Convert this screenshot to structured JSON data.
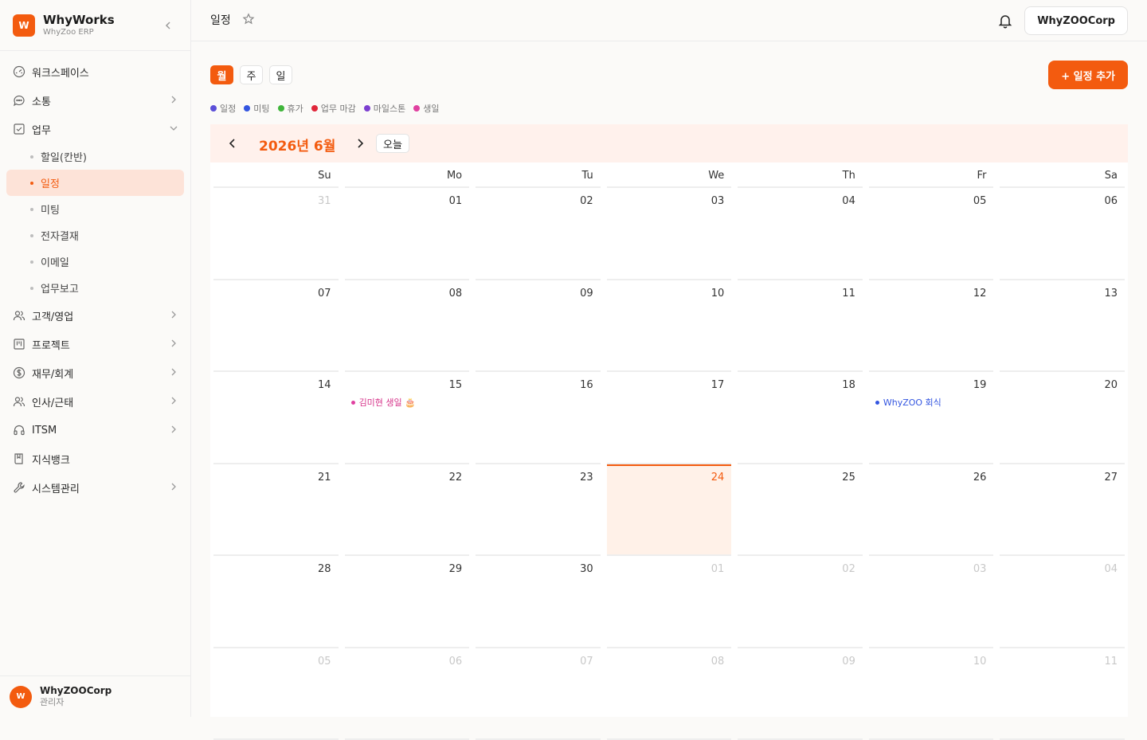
{
  "brand": {
    "logo": "W",
    "name": "WhyWorks",
    "sub": "WhyZoo ERP"
  },
  "nav": {
    "workspace": "워크스페이스",
    "communication": "소통",
    "work": "업무",
    "work_sub": [
      "할일(칸반)",
      "일정",
      "미팅",
      "전자결재",
      "이메일",
      "업무보고"
    ],
    "customers": "고객/영업",
    "projects": "프로젝트",
    "finance": "재무/회계",
    "hr": "인사/근태",
    "itsm": "ITSM",
    "knowledge": "지식뱅크",
    "system": "시스템관리"
  },
  "user": {
    "avatar": "W",
    "name": "WhyZOOCorp",
    "role": "관리자"
  },
  "topbar": {
    "title": "일정",
    "org": "WhyZOOCorp"
  },
  "view_tabs": [
    "월",
    "주",
    "일"
  ],
  "add_button": "+ 일정 추가",
  "legend": [
    {
      "label": "일정",
      "color": "#5b4fd8"
    },
    {
      "label": "미팅",
      "color": "#3355e0"
    },
    {
      "label": "휴가",
      "color": "#3fb53a"
    },
    {
      "label": "업무 마감",
      "color": "#e0263a"
    },
    {
      "label": "마일스톤",
      "color": "#7c3fd0"
    },
    {
      "label": "생일",
      "color": "#e040a0"
    }
  ],
  "calendar": {
    "title": "2026년 6월",
    "today_label": "오늘",
    "weekdays": [
      "Su",
      "Mo",
      "Tu",
      "We",
      "Th",
      "Fr",
      "Sa"
    ],
    "days": [
      [
        "31",
        "01",
        "02",
        "03",
        "04",
        "05",
        "06"
      ],
      [
        "07",
        "08",
        "09",
        "10",
        "11",
        "12",
        "13"
      ],
      [
        "14",
        "15",
        "16",
        "17",
        "18",
        "19",
        "20"
      ],
      [
        "21",
        "22",
        "23",
        "24",
        "25",
        "26",
        "27"
      ],
      [
        "28",
        "29",
        "30",
        "01",
        "02",
        "03",
        "04"
      ],
      [
        "05",
        "06",
        "07",
        "08",
        "09",
        "10",
        "11"
      ]
    ],
    "events": {
      "birthday": {
        "label": "김미현 생일 🎂",
        "color": "#d6338a"
      },
      "dinner": {
        "label": "WhyZOO 회식",
        "color": "#3355e0"
      }
    }
  }
}
